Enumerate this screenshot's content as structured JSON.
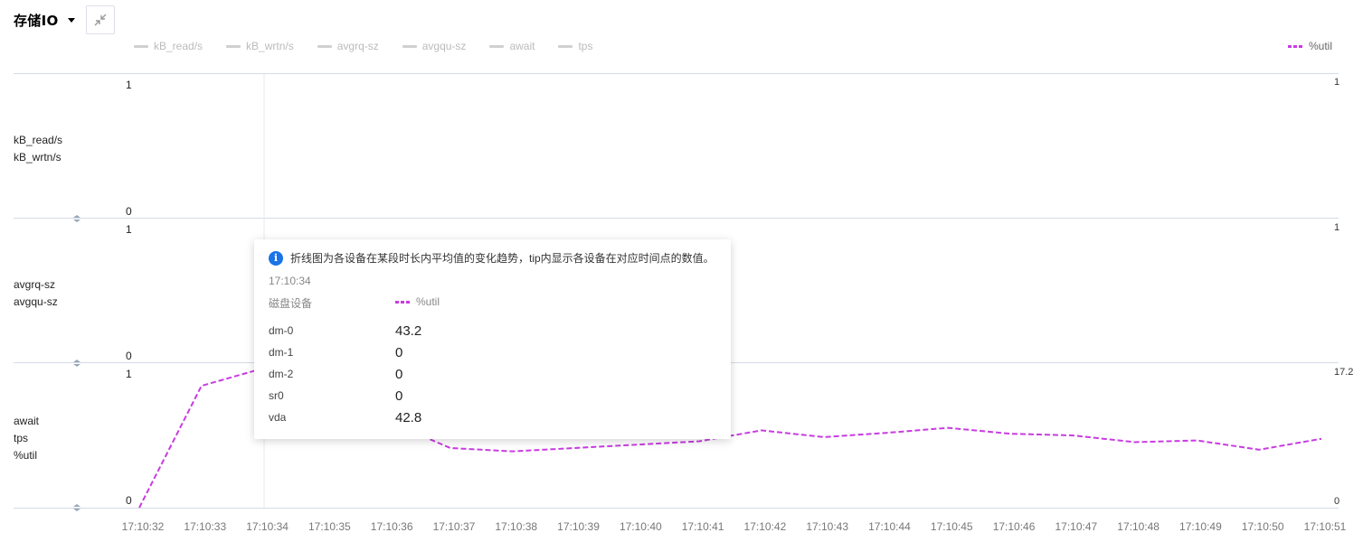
{
  "header": {
    "title": "存储IO"
  },
  "legend": {
    "items": [
      "kB_read/s",
      "kB_wrtn/s",
      "avgrq-sz",
      "avgqu-sz",
      "await",
      "tps"
    ],
    "right_item": "%util",
    "right_color": "#c83ce0"
  },
  "panels": [
    {
      "labels": [
        "kB_read/s",
        "kB_wrtn/s"
      ],
      "y_left_max": "1",
      "y_left_min": "0",
      "y_right_max": "1"
    },
    {
      "labels": [
        "avgrq-sz",
        "avgqu-sz"
      ],
      "y_left_max": "1",
      "y_left_min": "0",
      "y_right_max": "1"
    },
    {
      "labels": [
        "await",
        "tps",
        "%util"
      ],
      "y_left_max": "1",
      "y_left_min": "0",
      "y_right_max": "17.2",
      "y_right_min": "0"
    }
  ],
  "tooltip": {
    "note": "折线图为各设备在某段时长内平均值的变化趋势，tip内显示各设备在对应时间点的数值。",
    "time": "17:10:34",
    "col_device": "磁盘设备",
    "col_metric": "%util",
    "rows": [
      {
        "device": "dm-0",
        "value": "43.2"
      },
      {
        "device": "dm-1",
        "value": "0"
      },
      {
        "device": "dm-2",
        "value": "0"
      },
      {
        "device": "sr0",
        "value": "0"
      },
      {
        "device": "vda",
        "value": "42.8"
      }
    ]
  },
  "chart_data": {
    "type": "line",
    "x": [
      "17:10:32",
      "17:10:33",
      "17:10:34",
      "17:10:35",
      "17:10:36",
      "17:10:37",
      "17:10:38",
      "17:10:39",
      "17:10:40",
      "17:10:41",
      "17:10:42",
      "17:10:43",
      "17:10:44",
      "17:10:45",
      "17:10:46",
      "17:10:47",
      "17:10:48",
      "17:10:49",
      "17:10:50",
      "17:10:51"
    ],
    "series": [
      {
        "name": "%util",
        "axis": "right",
        "color": "#c83ce0",
        "dash": true,
        "values": [
          0,
          14.5,
          16.6,
          null,
          null,
          7.1,
          6.7,
          null,
          null,
          7.9,
          9.2,
          8.4,
          8.9,
          9.5,
          8.8,
          8.6,
          7.8,
          8.0,
          6.9,
          8.2
        ]
      }
    ],
    "panel3_right_ylim": [
      0,
      17.2
    ],
    "grid": true,
    "legend_position": "top"
  }
}
